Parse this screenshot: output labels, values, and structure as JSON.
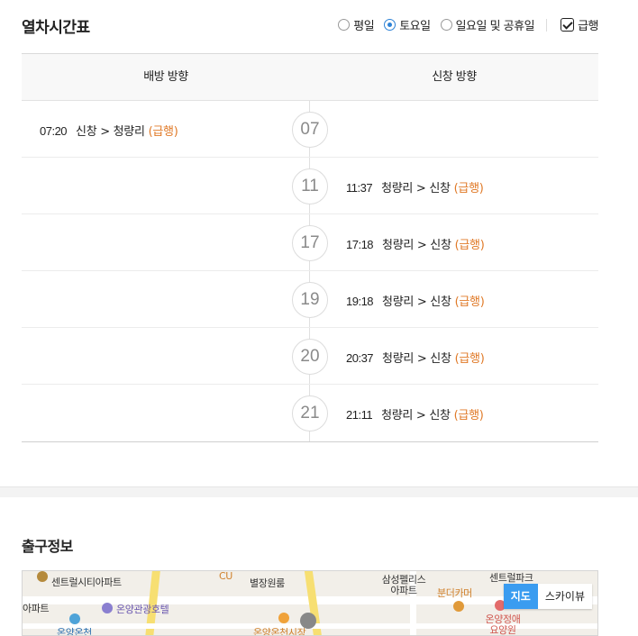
{
  "header": {
    "title": "열차시간표",
    "filters": [
      {
        "label": "평일",
        "selected": false
      },
      {
        "label": "토요일",
        "selected": true
      },
      {
        "label": "일요일 및 공휴일",
        "selected": false
      }
    ],
    "express_checkbox": {
      "label": "급행",
      "checked": true
    }
  },
  "table": {
    "columns": [
      "배방 방향",
      "신창 방향"
    ],
    "rows": [
      {
        "hour": "07",
        "left": {
          "time": "07:20",
          "route": "신창 > 청량리",
          "tag": "(급행)"
        },
        "right": null
      },
      {
        "hour": "11",
        "left": null,
        "right": {
          "time": "11:37",
          "route": "청량리 > 신창",
          "tag": "(급행)"
        }
      },
      {
        "hour": "17",
        "left": null,
        "right": {
          "time": "17:18",
          "route": "청량리 > 신창",
          "tag": "(급행)"
        }
      },
      {
        "hour": "19",
        "left": null,
        "right": {
          "time": "19:18",
          "route": "청량리 > 신창",
          "tag": "(급행)"
        }
      },
      {
        "hour": "20",
        "left": null,
        "right": {
          "time": "20:37",
          "route": "청량리 > 신창",
          "tag": "(급행)"
        }
      },
      {
        "hour": "21",
        "left": null,
        "right": {
          "time": "21:11",
          "route": "청량리 > 신창",
          "tag": "(급행)"
        }
      }
    ]
  },
  "exit_info": {
    "title": "출구정보",
    "map": {
      "labels": [
        "센트럴시티아파트",
        "CU",
        "별장원룸",
        "삼성펠리스 아파트",
        "센트럴파크",
        "아파트",
        "온양관광호텔",
        "분더카머",
        "온양정애 요양원",
        "온양온천시장",
        "온양온천"
      ],
      "toggle": [
        {
          "label": "지도",
          "active": true
        },
        {
          "label": "스카이뷰",
          "active": false
        }
      ]
    }
  },
  "colors": {
    "express": "#e07a28",
    "accent": "#2d82d6",
    "map_active": "#3a9cf0"
  }
}
